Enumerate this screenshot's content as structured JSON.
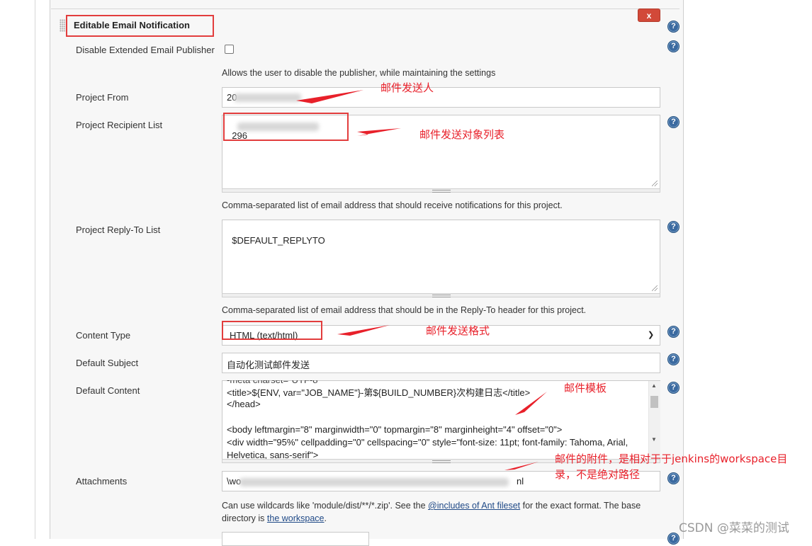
{
  "section": {
    "title": "Editable Email Notification",
    "close_label": "x",
    "help_label": "?"
  },
  "fields": {
    "disable_publisher": {
      "label": "Disable Extended Email Publisher",
      "checked": false,
      "description": "Allows the user to disable the publisher, while maintaining the settings"
    },
    "project_from": {
      "label": "Project From",
      "value": "20"
    },
    "recipient_list": {
      "label": "Project Recipient List",
      "value": "296",
      "description": "Comma-separated list of email address that should receive notifications for this project."
    },
    "reply_to": {
      "label": "Project Reply-To List",
      "value": "$DEFAULT_REPLYTO",
      "description": "Comma-separated list of email address that should be in the Reply-To header for this project."
    },
    "content_type": {
      "label": "Content Type",
      "selected": "HTML (text/html)"
    },
    "default_subject": {
      "label": "Default Subject",
      "value": "自动化测试邮件发送"
    },
    "default_content": {
      "label": "Default Content",
      "lines": [
        "<title>${ENV, var=\"JOB_NAME\"}-第${BUILD_NUMBER}次构建日志</title>",
        "</head>",
        "",
        "<body leftmargin=\"8\" marginwidth=\"0\" topmargin=\"8\" marginheight=\"4\" offset=\"0\">",
        "<div width=\"95%\" cellpadding=\"0\" cellspacing=\"0\" style=\"font-size: 11pt; font-family: Tahoma, Arial,",
        "Helvetica, sans-serif\">"
      ]
    },
    "attachments": {
      "label": "Attachments",
      "value_start": "\\wo",
      "value_end": "nl",
      "description_pre": "Can use wildcards like 'module/dist/**/*.zip'. See the ",
      "link_includes": "@includes of Ant fileset",
      "description_mid": " for the exact format. The base",
      "description_line2_pre": "directory is ",
      "link_workspace": "the workspace",
      "description_line2_post": "."
    }
  },
  "annotations": {
    "sender": "邮件发送人",
    "recipients": "邮件发送对象列表",
    "format": "邮件发送格式",
    "template": "邮件模板",
    "attachments_line1": "邮件的附件，是相对于于jenkins的workspace目",
    "attachments_line2": "录，不是绝对路径"
  },
  "watermark": "CSDN @菜菜的测试",
  "colors": {
    "annotation_red": "#e8202a",
    "close_button": "#d24939",
    "help_icon": "#3b6aa0",
    "link": "#204a87"
  }
}
